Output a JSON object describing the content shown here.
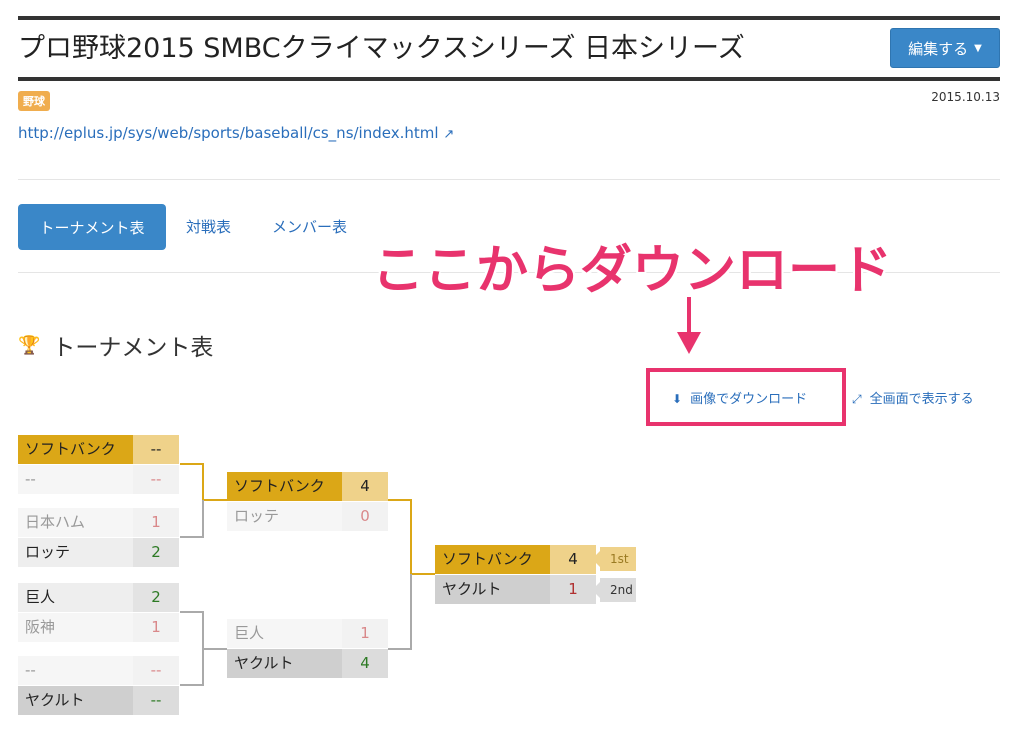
{
  "header": {
    "title": "プロ野球2015 SMBCクライマックスシリーズ 日本シリーズ",
    "edit_label": "編集する",
    "category_tag": "野球",
    "date": "2015.10.13",
    "url": "http://eplus.jp/sys/web/sports/baseball/cs_ns/index.html"
  },
  "tabs": [
    {
      "label": "トーナメント表",
      "active": true
    },
    {
      "label": "対戦表",
      "active": false
    },
    {
      "label": "メンバー表",
      "active": false
    }
  ],
  "annotation": {
    "text": "ここからダウンロード",
    "color": "#e8336d"
  },
  "section": {
    "title": "トーナメント表",
    "download_label": "画像でダウンロード",
    "fullscreen_label": "全画面で表示する"
  },
  "bracket": {
    "round1": [
      {
        "name": "ソフトバンク",
        "score": "--"
      },
      {
        "name": "--",
        "score": "--"
      },
      {
        "name": "日本ハム",
        "score": "1"
      },
      {
        "name": "ロッテ",
        "score": "2"
      },
      {
        "name": "巨人",
        "score": "2"
      },
      {
        "name": "阪神",
        "score": "1"
      },
      {
        "name": "--",
        "score": "--"
      },
      {
        "name": "ヤクルト",
        "score": "--"
      }
    ],
    "round2": [
      {
        "name": "ソフトバンク",
        "score": "4"
      },
      {
        "name": "ロッテ",
        "score": "0"
      },
      {
        "name": "巨人",
        "score": "1"
      },
      {
        "name": "ヤクルト",
        "score": "4"
      }
    ],
    "final": [
      {
        "name": "ソフトバンク",
        "score": "4",
        "rank": "1st"
      },
      {
        "name": "ヤクルト",
        "score": "1",
        "rank": "2nd"
      }
    ]
  },
  "colors": {
    "accent": "#3a87c8",
    "winner_gold": "#dba717",
    "annotation_pink": "#e8336d"
  }
}
